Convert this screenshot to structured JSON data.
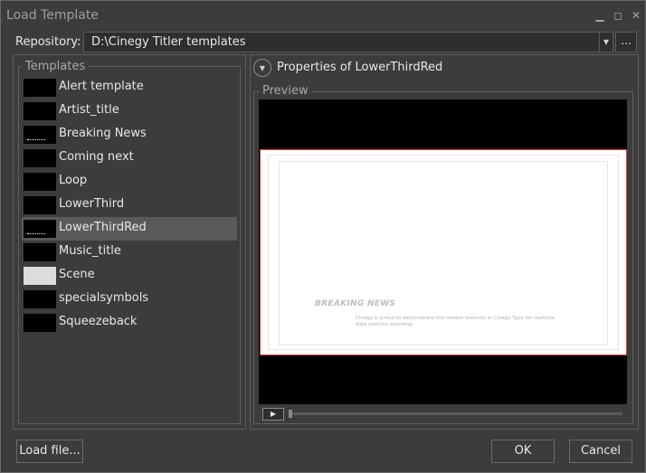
{
  "window": {
    "title": "Load Template"
  },
  "repository": {
    "label": "Repository:",
    "value": "D:\\Cinegy Titler templates",
    "browse_label": "..."
  },
  "templates": {
    "legend": "Templates",
    "items": [
      {
        "name": "Alert template",
        "thumb": "dark"
      },
      {
        "name": "Artist_title",
        "thumb": "dark"
      },
      {
        "name": "Breaking News",
        "thumb": "dots"
      },
      {
        "name": "Coming next",
        "thumb": "dark"
      },
      {
        "name": "Loop",
        "thumb": "dark"
      },
      {
        "name": "LowerThird",
        "thumb": "dark"
      },
      {
        "name": "LowerThirdRed",
        "thumb": "dots",
        "selected": true
      },
      {
        "name": "Music_title",
        "thumb": "dark"
      },
      {
        "name": "Scene",
        "thumb": "light"
      },
      {
        "name": "specialsymbols",
        "thumb": "dark"
      },
      {
        "name": "Squeezeback",
        "thumb": "dark"
      }
    ]
  },
  "properties": {
    "title": "Properties of LowerThirdRed"
  },
  "preview": {
    "legend": "Preview",
    "headline": "BREAKING NEWS",
    "subline": "Cinegy is proud to demonstrate the newest features in Cinegy Type for realtime, data reactive branding",
    "play_glyph": "▶"
  },
  "buttons": {
    "load_file": "Load file...",
    "ok": "OK",
    "cancel": "Cancel"
  },
  "colors": {
    "background": "#3c3c3c",
    "accent_border": "#d23a3a",
    "selected_row": "#5a5a5a"
  }
}
